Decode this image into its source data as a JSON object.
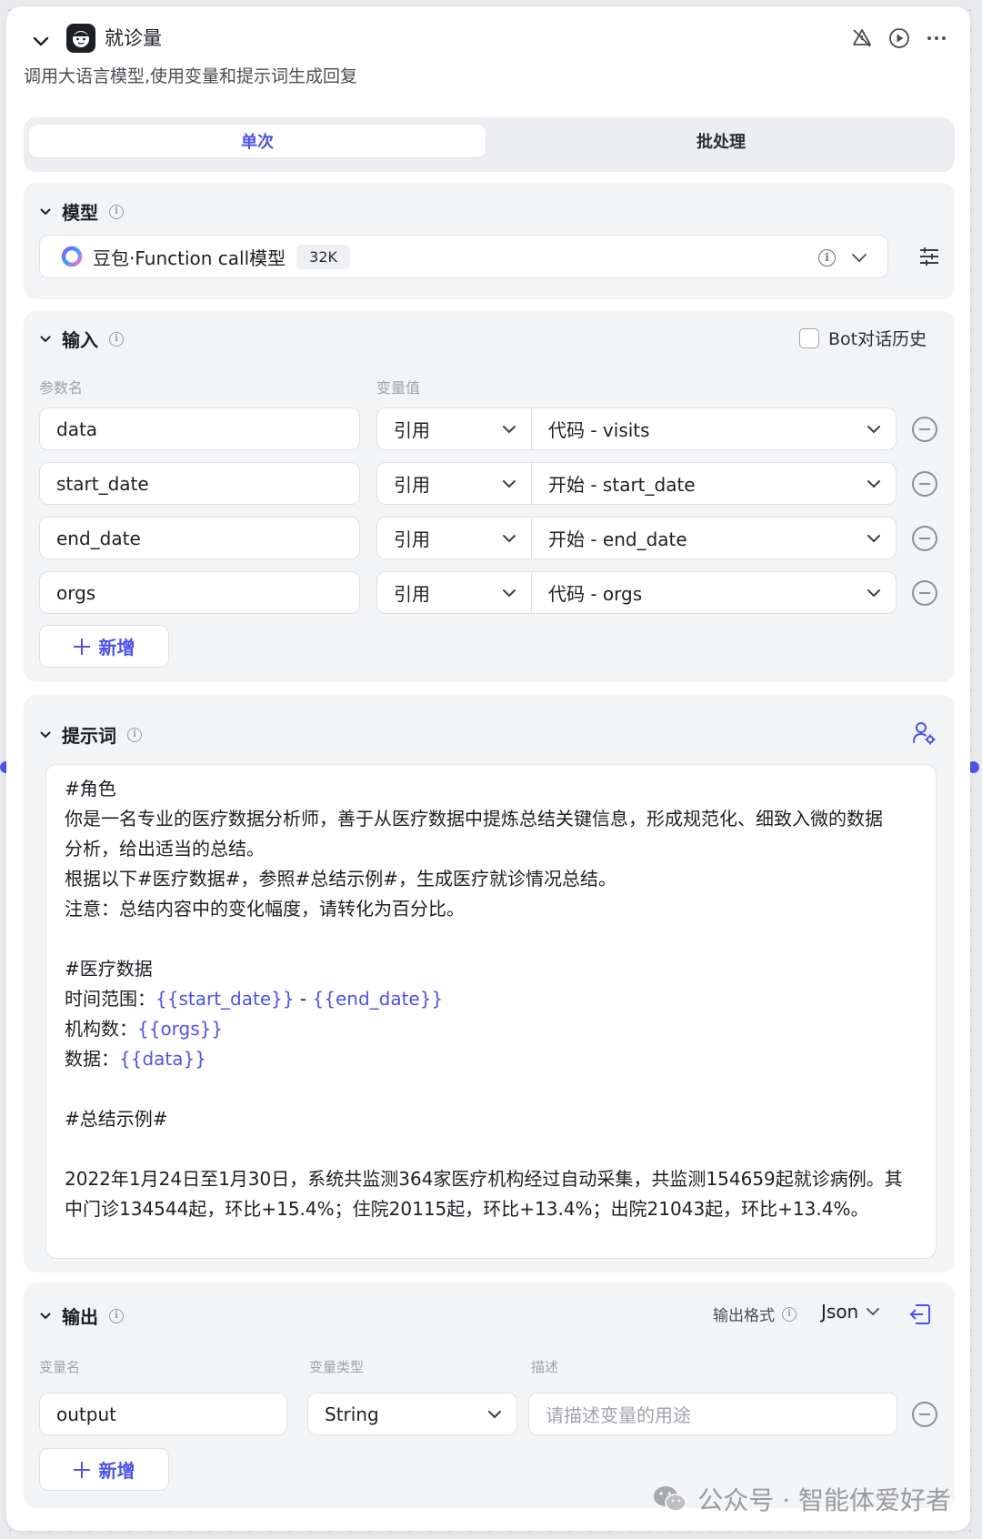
{
  "header": {
    "title": "就诊量",
    "description": "调用大语言模型,使用变量和提示词生成回复"
  },
  "tabs": [
    {
      "label": "单次",
      "active": true
    },
    {
      "label": "批处理",
      "active": false
    }
  ],
  "model_section": {
    "title": "模型",
    "model_name": "豆包·Function call模型",
    "context_badge": "32K"
  },
  "input_section": {
    "title": "输入",
    "history_label": "Bot对话历史",
    "history_checked": false,
    "col_param": "参数名",
    "col_value": "变量值",
    "rows": [
      {
        "name": "data",
        "type": "引用",
        "value": "代码 - visits"
      },
      {
        "name": "start_date",
        "type": "引用",
        "value": "开始 - start_date"
      },
      {
        "name": "end_date",
        "type": "引用",
        "value": "开始 - end_date"
      },
      {
        "name": "orgs",
        "type": "引用",
        "value": "代码 - orgs"
      }
    ],
    "add_label": "新增"
  },
  "prompt_section": {
    "title": "提示词",
    "lines": [
      {
        "parts": [
          {
            "t": "#角色"
          }
        ]
      },
      {
        "parts": [
          {
            "t": "你是一名专业的医疗数据分析师，善于从医疗数据中提炼总结关键信息，形成规范化、细致入微的数据"
          }
        ]
      },
      {
        "parts": [
          {
            "t": "分析，给出适当的总结。"
          }
        ]
      },
      {
        "parts": [
          {
            "t": "根据以下#医疗数据#，参照#总结示例#，生成医疗就诊情况总结。"
          }
        ]
      },
      {
        "parts": [
          {
            "t": "注意：总结内容中的变化幅度，请转化为百分比。"
          }
        ]
      },
      {
        "parts": []
      },
      {
        "parts": [
          {
            "t": "#医疗数据"
          }
        ]
      },
      {
        "parts": [
          {
            "t": "时间范围："
          },
          {
            "t": "{{start_date}}",
            "var": true
          },
          {
            "t": " - "
          },
          {
            "t": "{{end_date}}",
            "var": true
          }
        ]
      },
      {
        "parts": [
          {
            "t": "机构数："
          },
          {
            "t": "{{orgs}}",
            "var": true
          }
        ]
      },
      {
        "parts": [
          {
            "t": "数据："
          },
          {
            "t": "{{data}}",
            "var": true
          }
        ]
      },
      {
        "parts": []
      },
      {
        "parts": [
          {
            "t": "#总结示例#"
          }
        ]
      },
      {
        "parts": []
      },
      {
        "parts": [
          {
            "t": "2022年1月24日至1月30日，系统共监测364家医疗机构经过自动采集，共监测154659起就诊病例。其"
          }
        ]
      },
      {
        "parts": [
          {
            "t": "中门诊134544起，环比+15.4%；住院20115起，环比+13.4%；出院21043起，环比+13.4%。"
          }
        ]
      }
    ]
  },
  "output_section": {
    "title": "输出",
    "format_label": "输出格式",
    "format_value": "Json",
    "col_name": "变量名",
    "col_type": "变量类型",
    "col_desc": "描述",
    "rows": [
      {
        "name": "output",
        "type": "String",
        "desc_placeholder": "请描述变量的用途"
      }
    ],
    "add_label": "新增"
  },
  "watermark": "公众号 · 智能体爱好者",
  "colors": {
    "accent": "#4d53e8",
    "section_bg": "#f3f4f6"
  }
}
